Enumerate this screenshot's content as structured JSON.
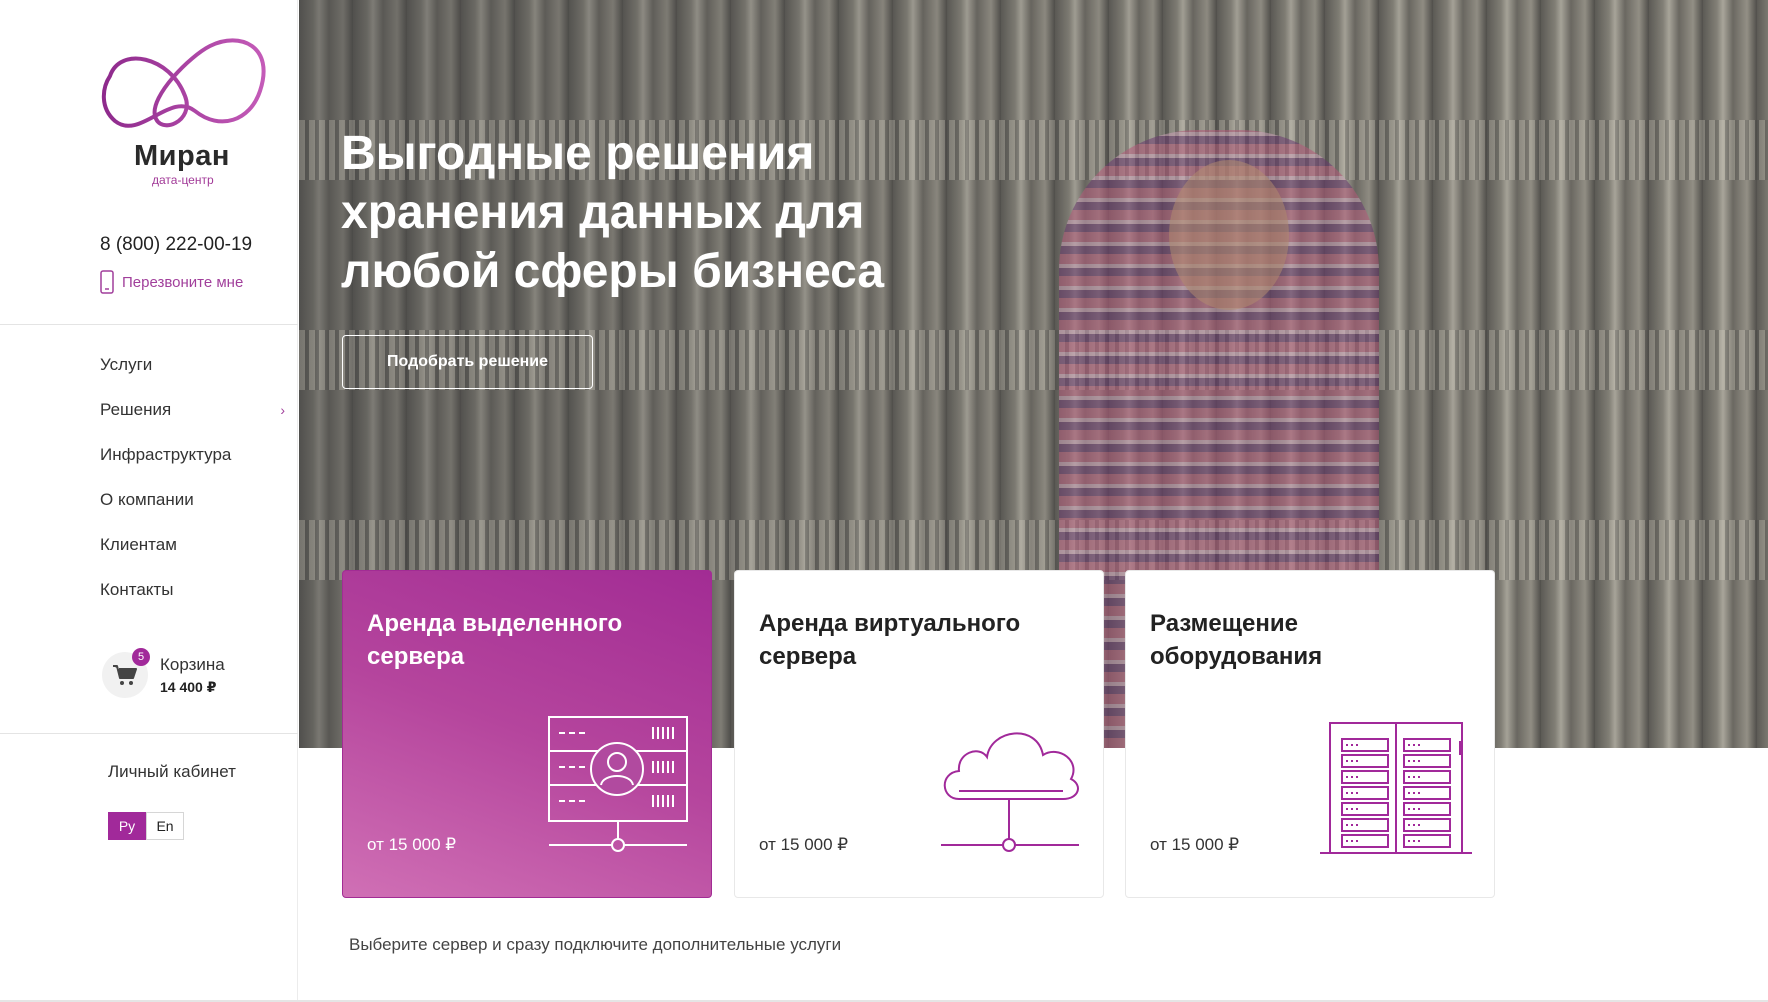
{
  "brand": {
    "name": "Миран",
    "subtitle": "дата-центр",
    "accent_color": "#a1299a"
  },
  "contacts": {
    "phone": "8 (800) 222-00-19",
    "callback_label": "Перезвоните мне",
    "callback_icon": "phone-icon"
  },
  "nav": {
    "items": [
      {
        "label": "Услуги"
      },
      {
        "label": "Решения"
      },
      {
        "label": "Инфраструктура"
      },
      {
        "label": "О компании"
      },
      {
        "label": "Клиентам"
      },
      {
        "label": "Контакты"
      }
    ],
    "expand_icon": "›"
  },
  "cart": {
    "count": "5",
    "label": "Корзина",
    "sum": "14 400 ₽",
    "icon": "cart-icon"
  },
  "account": {
    "label": "Личный кабинет"
  },
  "languages": {
    "active": "Ру",
    "other": "En"
  },
  "hero": {
    "title": "Выгодные решения хранения данных для любой сферы бизнеса",
    "button_label": "Подобрать решение"
  },
  "cards": [
    {
      "title": "Аренда выделенного сервера",
      "price": "от 15 000 ₽",
      "icon": "dedicated-server-icon"
    },
    {
      "title": "Аренда виртуального сервера",
      "price": "от 15 000 ₽",
      "icon": "cloud-server-icon"
    },
    {
      "title": "Размещение оборудования",
      "price": "от 15 000 ₽",
      "icon": "server-rack-icon"
    }
  ],
  "subtext": "Выберите сервер и сразу подключите дополнительные услуги"
}
